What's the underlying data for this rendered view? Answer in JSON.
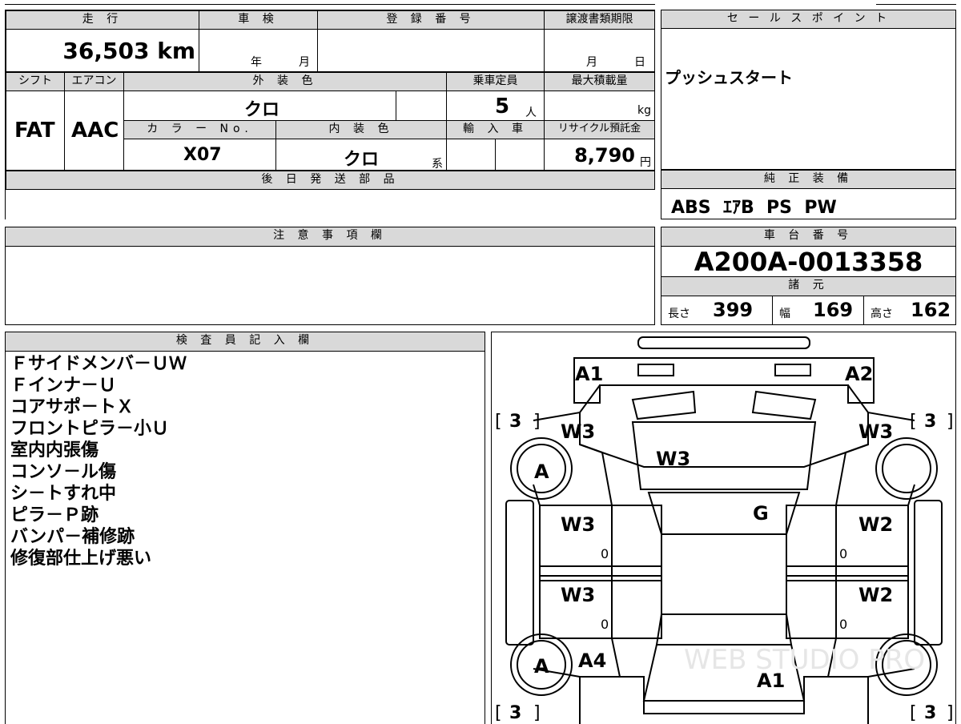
{
  "vehicle": {
    "mileage_label": "走 行",
    "mileage_value": "36,503 km",
    "inspection_label": "車 検",
    "inspection_year_unit": "年",
    "inspection_month_unit": "月",
    "registration_label": "登 録 番 号",
    "transfer_label": "譲渡書類期限",
    "transfer_month_unit": "月",
    "transfer_day_unit": "日",
    "shift_label": "シフト",
    "shift_value": "FAT",
    "ac_label": "エアコン",
    "ac_value": "AAC",
    "exterior_label": "外 装 色",
    "exterior_value": "クロ",
    "capacity_label": "乗車定員",
    "capacity_value": "5",
    "capacity_unit": "人",
    "load_label": "最大積載量",
    "load_unit": "kg",
    "color_no_label": "カ ラ ー No.",
    "color_no_value": "X07",
    "interior_label": "内 装 色",
    "interior_value": "クロ",
    "interior_unit": "系",
    "import_label": "輸 入 車",
    "recycle_label": "リサイクル預託金",
    "recycle_value": "8,790",
    "recycle_unit": "円",
    "later_parts_label": "後 日 発 送 部 品"
  },
  "sales_point": {
    "label": "セ ー ル ス ポ イ ン ト",
    "text": "プッシュスタート"
  },
  "equipment": {
    "label": "純 正 装 備",
    "text": "ABS  ｴｱB  PS  PW"
  },
  "caution": {
    "label": "注 意 事 項 欄"
  },
  "chassis": {
    "label": "車 台 番 号",
    "value": "A200A-0013358",
    "specs_label": "諸 元",
    "length_label": "長さ",
    "length_value": "399",
    "width_label": "幅",
    "width_value": "169",
    "height_label": "高さ",
    "height_value": "162"
  },
  "inspector": {
    "label": "検 査 員 記 入 欄",
    "notes": [
      "Ｆサイドメンバ－ＵＷ",
      "Ｆインナ－Ｕ",
      "コアサポ－トＸ",
      "フロントピラ－小Ｕ",
      "室内内張傷",
      "コンソ－ル傷",
      "シ－トすれ中",
      "ピラ－Ｐ跡",
      "バンパ－補修跡",
      "修復部仕上げ悪い"
    ]
  },
  "diagram": {
    "marks": {
      "front_left": "A1",
      "front_right": "A2",
      "fender_left": "W3",
      "fender_right": "W3",
      "hood": "W3",
      "roof": "G",
      "front_door_left": "W3",
      "front_door_right": "W2",
      "rear_door_left": "W3",
      "rear_door_right": "W2",
      "wheel_front_left": "A",
      "wheel_rear_left": "A",
      "rear_quarter_left": "A4",
      "rear": "A1",
      "door_zero_1": "0",
      "door_zero_2": "0",
      "door_zero_3": "0",
      "door_zero_4": "0"
    },
    "tires": {
      "front_left": "3",
      "front_right": "3",
      "rear_left": "3",
      "rear_right": "3"
    },
    "bracket_open": "[",
    "bracket_close": "]",
    "watermark": "WEB STUDIO PRO"
  }
}
